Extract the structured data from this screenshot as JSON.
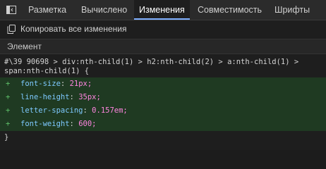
{
  "tabs": [
    {
      "label": "Разметка",
      "active": false
    },
    {
      "label": "Вычислено",
      "active": false
    },
    {
      "label": "Изменения",
      "active": true
    },
    {
      "label": "Совместимость",
      "active": false
    },
    {
      "label": "Шрифты",
      "active": false
    }
  ],
  "toolbar": {
    "copy_all_label": "Копировать все изменения"
  },
  "section": {
    "title": "Элемент"
  },
  "rule": {
    "selector_line1": "#\\39 90698 > div:nth-child(1) > h2:nth-child(2) > a:nth-child(1) >",
    "selector_line2": "span:nth-child(1) {",
    "closing": "}",
    "declarations": [
      {
        "marker": "+",
        "property": "font-size",
        "value": "21px;"
      },
      {
        "marker": "+",
        "property": "line-height",
        "value": "35px;"
      },
      {
        "marker": "+",
        "property": "letter-spacing",
        "value": "0.157em;"
      },
      {
        "marker": "+",
        "property": "font-weight",
        "value": "600;"
      }
    ]
  },
  "colors": {
    "added_background": "#1f3a22",
    "active_tab_indicator": "#7fb0ff",
    "property": "#7ec9ff",
    "value": "#ff85e0",
    "plus": "#5ec26a"
  },
  "icons": {
    "dock": "dock-side-icon",
    "copy": "copy-icon"
  }
}
